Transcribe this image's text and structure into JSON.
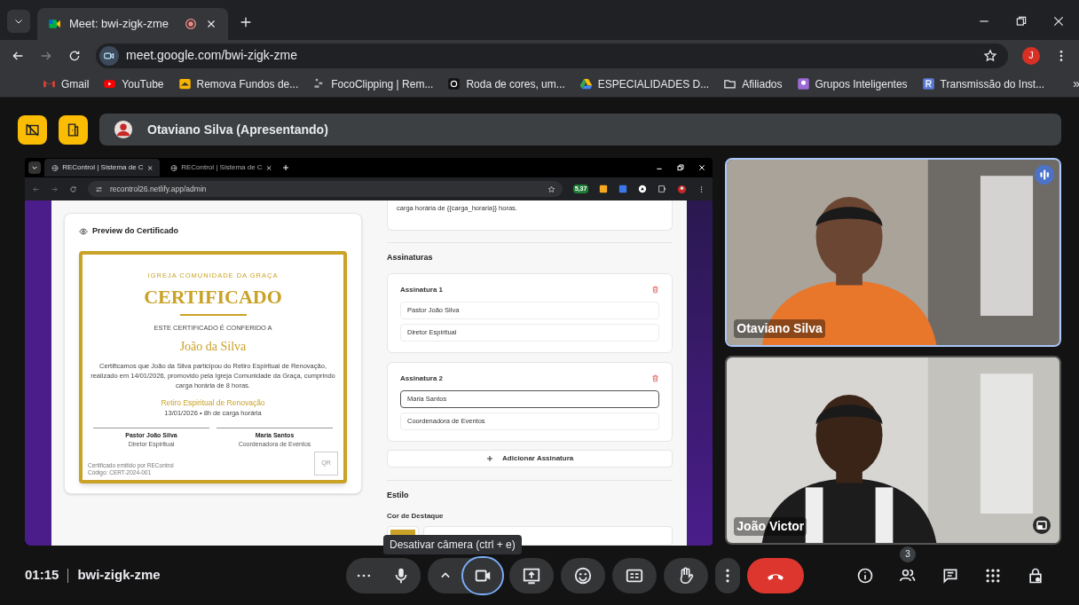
{
  "browser": {
    "tab_title": "Meet: bwi-zigk-zme",
    "url": "meet.google.com/bwi-zigk-zme",
    "profile_initial": "J",
    "bookmarks": [
      {
        "label": "Gmail",
        "kind": "gmail"
      },
      {
        "label": "YouTube",
        "kind": "youtube"
      },
      {
        "label": "Remova Fundos de...",
        "kind": "remove"
      },
      {
        "label": "FocoClipping | Rem...",
        "kind": "clip"
      },
      {
        "label": "Roda de cores, um...",
        "kind": "wheel"
      },
      {
        "label": "ESPECIALIDADES D...",
        "kind": "drive"
      },
      {
        "label": "Afiliados",
        "kind": "folder"
      },
      {
        "label": "Grupos Inteligentes",
        "kind": "groups"
      },
      {
        "label": "Transmissão do Inst...",
        "kind": "letter"
      }
    ],
    "overflow": "»"
  },
  "presenter_bar": {
    "label": "Otaviano Silva (Apresentando)"
  },
  "shared_screen": {
    "tabs": [
      {
        "label": "REControl | Sistema de C",
        "selected": true
      },
      {
        "label": "REControl | Sistema de C",
        "selected": false
      }
    ],
    "url": "recontrol26.netlify.app/admin",
    "extension_badge": "5,37",
    "preview": {
      "heading": "Preview do Certificado",
      "org": "IGREJA COMUNIDADE DA GRAÇA",
      "title": "CERTIFICADO",
      "conferred": "ESTE CERTIFICADO É CONFERIDO A",
      "recipient": "João da Silva",
      "body": "Certificamos que João da Silva participou do Retiro Espiritual de Renovação, realizado em 14/01/2026, promovido pela Igreja Comunidade da Graça, cumprindo carga horária de 8 horas.",
      "event": "Retiro Espiritual de Renovação",
      "event_meta": "13/01/2026 • 8h de carga horária",
      "signatures": [
        {
          "name": "Pastor João Silva",
          "role": "Diretor Espiritual"
        },
        {
          "name": "Maria Santos",
          "role": "Coordenadora de Eventos"
        }
      ],
      "issued": "Certificado emitido por REControl",
      "code": "Código: CERT-2024-001",
      "qr": "QR"
    },
    "form": {
      "template_tail": "carga horária de {{carga_horaria}} horas.",
      "signatures_heading": "Assinaturas",
      "signatures": [
        {
          "title": "Assinatura 1",
          "fields": [
            {
              "value": "Pastor João Silva",
              "focused": false
            },
            {
              "value": "Diretor Espiritual",
              "focused": false
            }
          ]
        },
        {
          "title": "Assinatura 2",
          "fields": [
            {
              "value": "Maria Santos",
              "focused": true
            },
            {
              "value": "Coordenadora de Eventos",
              "focused": false
            }
          ]
        }
      ],
      "add_button": "Adicionar Assinatura",
      "style_heading": "Estilo",
      "accent_label": "Cor de Destaque"
    }
  },
  "participants": [
    {
      "name": "Otaviano Silva",
      "speaking": true
    },
    {
      "name": "João Victor",
      "speaking": false
    }
  ],
  "call_bar": {
    "time": "01:15",
    "meeting_code": "bwi-zigk-zme",
    "tooltip": "Desativar câmera (ctrl + e)",
    "controls": [
      {
        "kind": "more"
      },
      {
        "kind": "mic"
      },
      {
        "kind": "caret"
      },
      {
        "kind": "camera",
        "focused": true
      },
      {
        "kind": "present"
      },
      {
        "kind": "emoji"
      },
      {
        "kind": "captions"
      },
      {
        "kind": "hand"
      },
      {
        "kind": "vmore"
      },
      {
        "kind": "hangup"
      }
    ],
    "side": [
      {
        "kind": "info"
      },
      {
        "kind": "people",
        "badge": "3"
      },
      {
        "kind": "chat"
      },
      {
        "kind": "apps"
      },
      {
        "kind": "host"
      }
    ]
  }
}
